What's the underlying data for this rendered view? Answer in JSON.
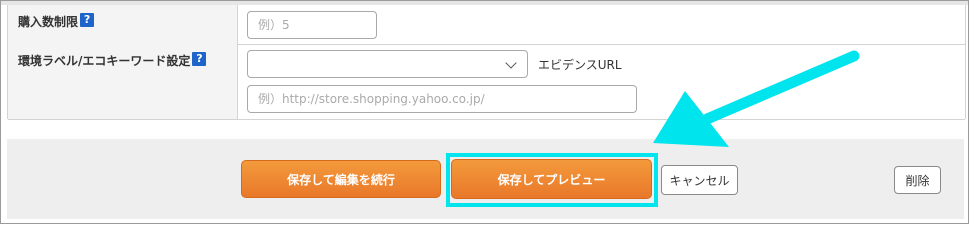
{
  "form": {
    "purchase_limit": {
      "label": "購入数制限",
      "placeholder": "例）5"
    },
    "env_label": {
      "label": "環境ラベル/エコキーワード設定",
      "select_value": "",
      "evidence_label": "エビデンスURL",
      "url_placeholder": "例）http://store.shopping.yahoo.co.jp/"
    },
    "help_glyph": "?"
  },
  "footer": {
    "save_continue_label": "保存して編集を続行",
    "save_preview_label": "保存してプレビュー",
    "cancel_label": "キャンセル",
    "delete_label": "削除"
  },
  "colors": {
    "accent_orange": "#ef8a33",
    "highlight_cyan": "#00e4ee",
    "help_icon_blue": "#1f64c8"
  }
}
